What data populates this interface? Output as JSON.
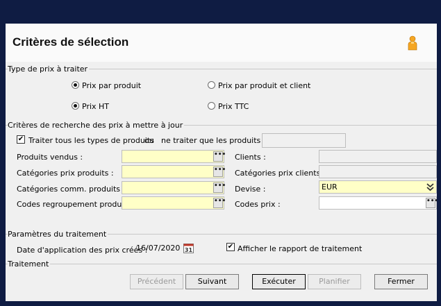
{
  "window": {
    "title": "Critères de sélection",
    "icon": "user-icon"
  },
  "sections": {
    "type_prix": "Type de prix à traiter",
    "criteres": "Critères de recherche des prix à mettre à jour",
    "parametres": "Paramètres du traitement",
    "traitement": "Traitement"
  },
  "type_prix": {
    "prix_par_produit": "Prix par produit",
    "prix_par_produit_client": "Prix par produit et client",
    "prix_ht": "Prix HT",
    "prix_ttc": "Prix TTC",
    "selected_type": "prix_par_produit",
    "selected_tax": "prix_ht"
  },
  "criteres": {
    "traiter_tous": "Traiter tous les types de produits",
    "traiter_tous_checked": true,
    "ou": "ou",
    "ne_traiter_que": "ne traiter que les produits :",
    "produits_vendus": "Produits vendus  :",
    "categories_prix_produits": "Catégories prix produits :",
    "categories_comm_produits": "Catégories comm. produits :",
    "codes_regroupement": "Codes regroupement produits :",
    "clients": "Clients :",
    "categories_prix_clients": "Catégories prix clients :",
    "devise": "Devise :",
    "devise_value": "EUR",
    "codes_prix": "Codes prix :",
    "ellipsis": "•••"
  },
  "parametres": {
    "date_label": "Date d'application des prix créés :",
    "date_value": "16/07/2020",
    "calendar_day": "31",
    "afficher_rapport": "Afficher le rapport de traitement",
    "afficher_rapport_checked": true
  },
  "buttons": {
    "precedent": "Précédent",
    "suivant": "Suivant",
    "executer": "Exécuter",
    "planifier": "Planifier",
    "fermer": "Fermer"
  },
  "colors": {
    "background": "#0f1c43",
    "field_yellow": "#ffffc7",
    "icon_orange": "#f5a623"
  }
}
